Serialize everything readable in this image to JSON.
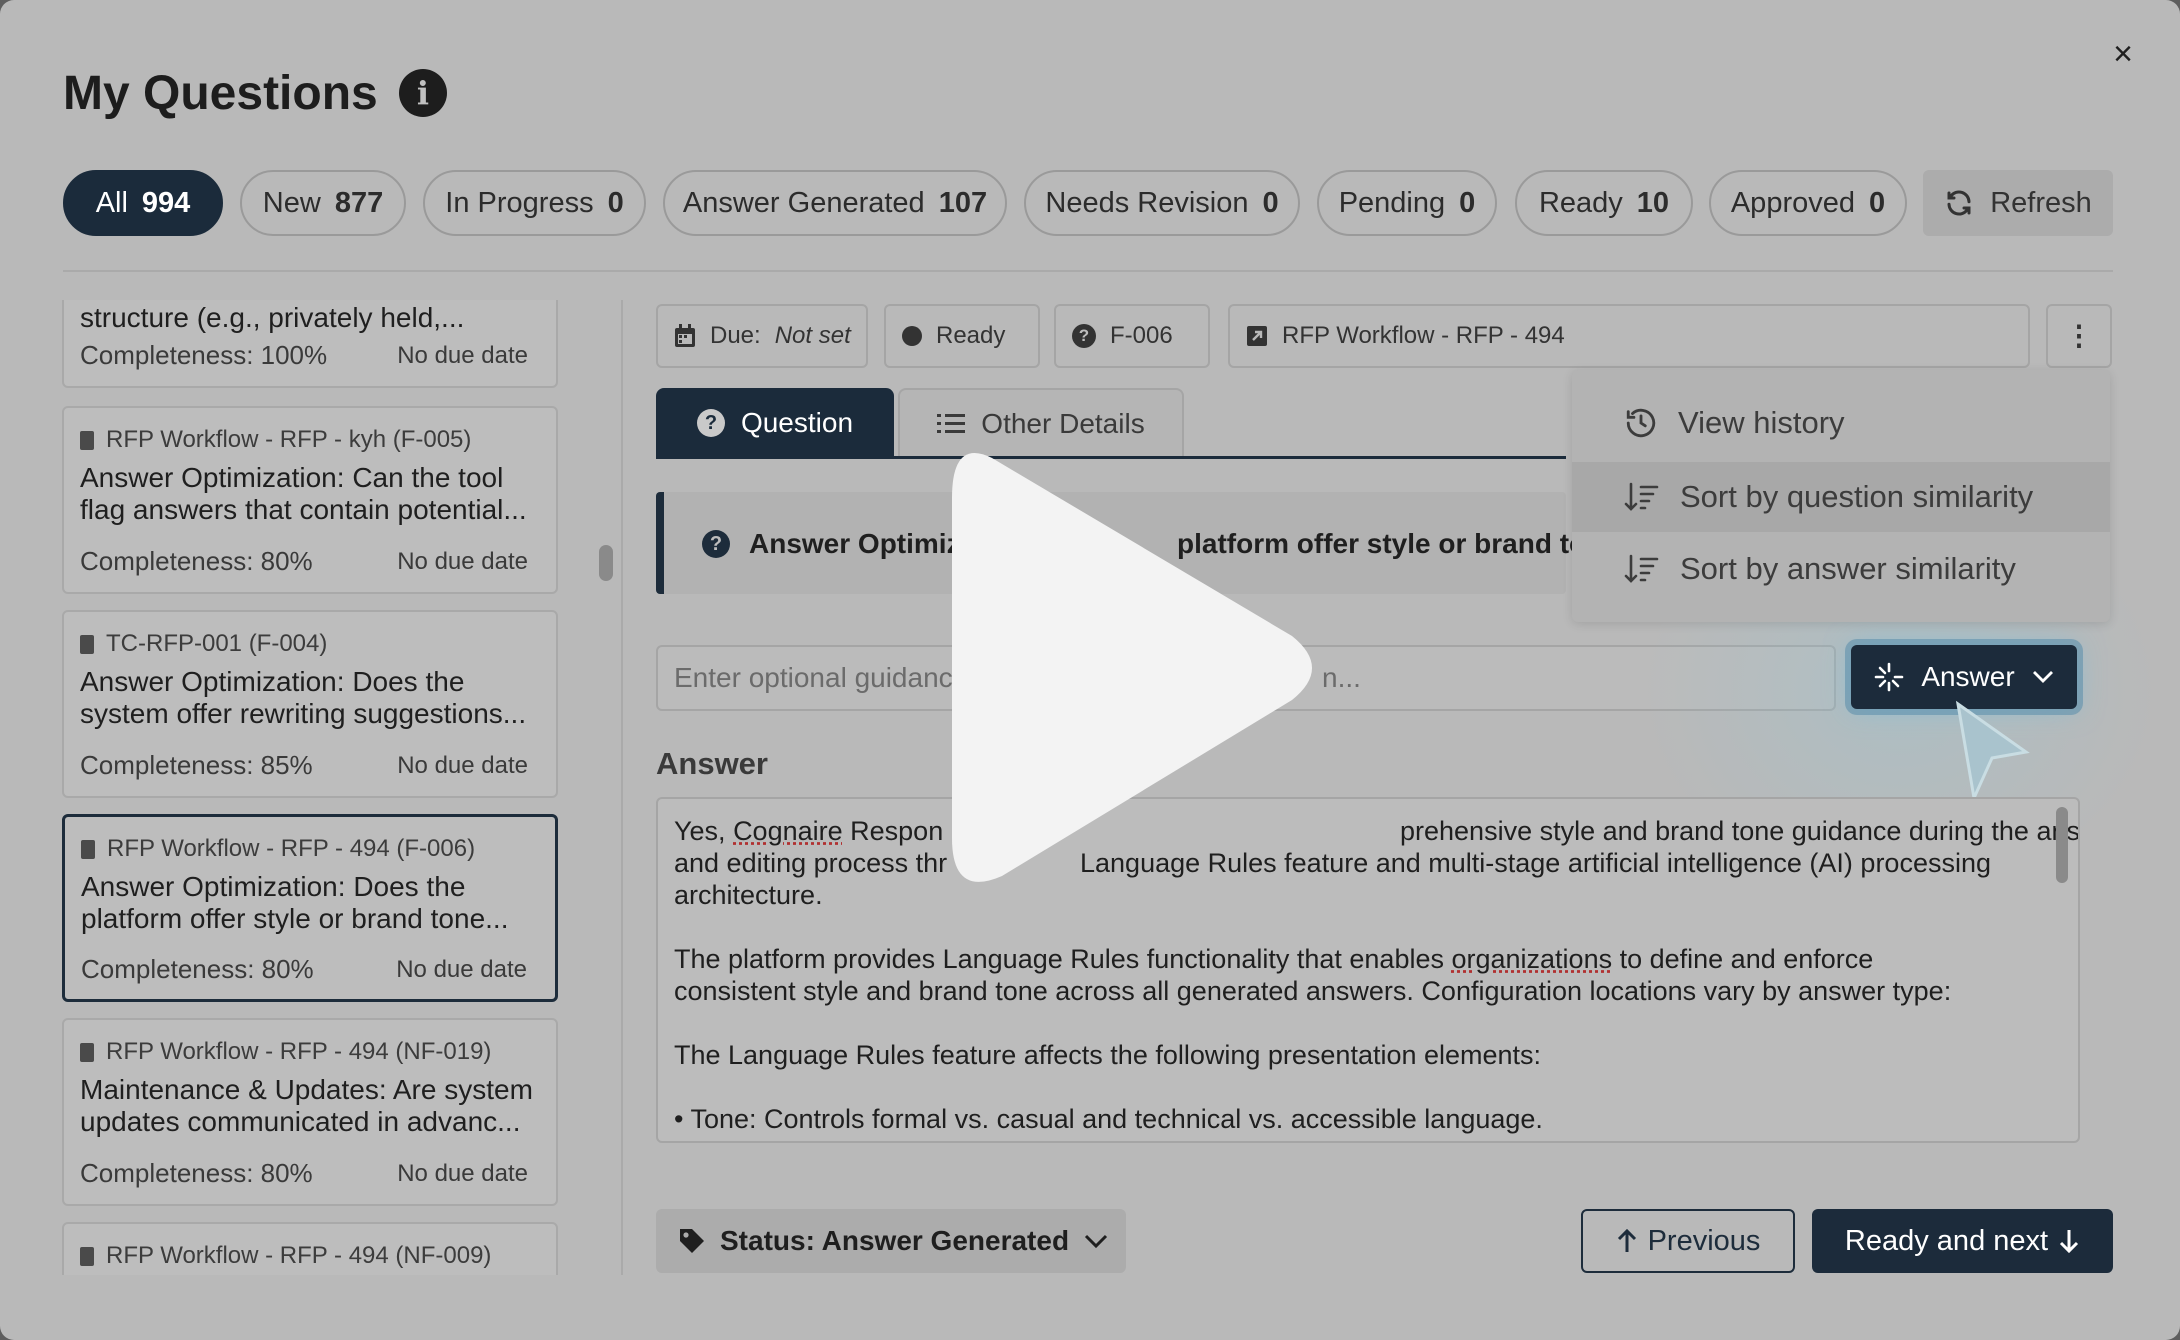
{
  "modal": {
    "title": "My Questions",
    "close_label": "×"
  },
  "filters": [
    {
      "label": "All",
      "count": "994",
      "active": true
    },
    {
      "label": "New",
      "count": "877"
    },
    {
      "label": "In Progress",
      "count": "0"
    },
    {
      "label": "Answer Generated",
      "count": "107"
    },
    {
      "label": "Needs Revision",
      "count": "0"
    },
    {
      "label": "Pending",
      "count": "0"
    },
    {
      "label": "Ready",
      "count": "10"
    },
    {
      "label": "Approved",
      "count": "0"
    }
  ],
  "refresh_label": "Refresh",
  "question_list": [
    {
      "title": "structure (e.g., privately held,...",
      "completeness": "Completeness: 100%",
      "due": "No due date"
    },
    {
      "source": "RFP Workflow - RFP - kyh (F-005)",
      "title": "Answer Optimization: Can the tool flag answers that contain potential...",
      "completeness": "Completeness: 80%",
      "due": "No due date"
    },
    {
      "source": "TC-RFP-001 (F-004)",
      "title": "Answer Optimization: Does the system offer rewriting suggestions...",
      "completeness": "Completeness: 85%",
      "due": "No due date"
    },
    {
      "source": "RFP Workflow - RFP - 494 (F-006)",
      "title": "Answer Optimization: Does the platform offer style or brand tone...",
      "completeness": "Completeness: 80%",
      "due": "No due date",
      "selected": true
    },
    {
      "source": "RFP Workflow - RFP - 494 (NF-019)",
      "title": "Maintenance & Updates: Are system updates communicated in advanc...",
      "completeness": "Completeness: 80%",
      "due": "No due date"
    },
    {
      "source": "RFP Workflow - RFP - 494 (NF-009)"
    }
  ],
  "detail": {
    "due_label": "Due:",
    "due_value": "Not set",
    "status_chip": "Ready",
    "id_chip": "F-006",
    "project_chip": "RFP Workflow - RFP - 494",
    "tabs": {
      "question": "Question",
      "other": "Other Details"
    },
    "question_text": "Answer Optimiz",
    "question_text_tail": "platform offer style or brand to",
    "guidance_placeholder_left": "Enter optional guidanc",
    "guidance_placeholder_right": "n...",
    "answer_button": "Answer",
    "answer_heading": "Answer",
    "answer_p1_a": "Yes, ",
    "answer_p1_link": "Cognaire",
    "answer_p1_b": " Respon",
    "answer_p1_c": "prehensive style and brand tone guidance during the answer generation",
    "answer_p1_line2a": "and editing process thr",
    "answer_p1_line2b": "Language Rules feature and multi-stage artificial intelligence (AI) processing",
    "answer_p1_line3": "architecture.",
    "answer_p2_line1a": "The platform provides Language Rules functionality that enables ",
    "answer_p2_link": "organizations",
    "answer_p2_line1b": " to define and enforce",
    "answer_p2_line2": "consistent style and brand tone across all generated answers. Configuration locations vary by answer type:",
    "answer_p3": "The Language Rules feature affects the following presentation elements:",
    "answer_p4": "• Tone: Controls formal vs. casual and technical vs. accessible language.",
    "status_button": "Status: Answer Generated",
    "previous_button": "Previous",
    "next_button": "Ready and next"
  },
  "menu": {
    "items": [
      "View history",
      "Sort by question similarity",
      "Sort by answer similarity"
    ]
  },
  "colors": {
    "primary": "#1c2b3b",
    "overlay": "#b9b9b9"
  }
}
